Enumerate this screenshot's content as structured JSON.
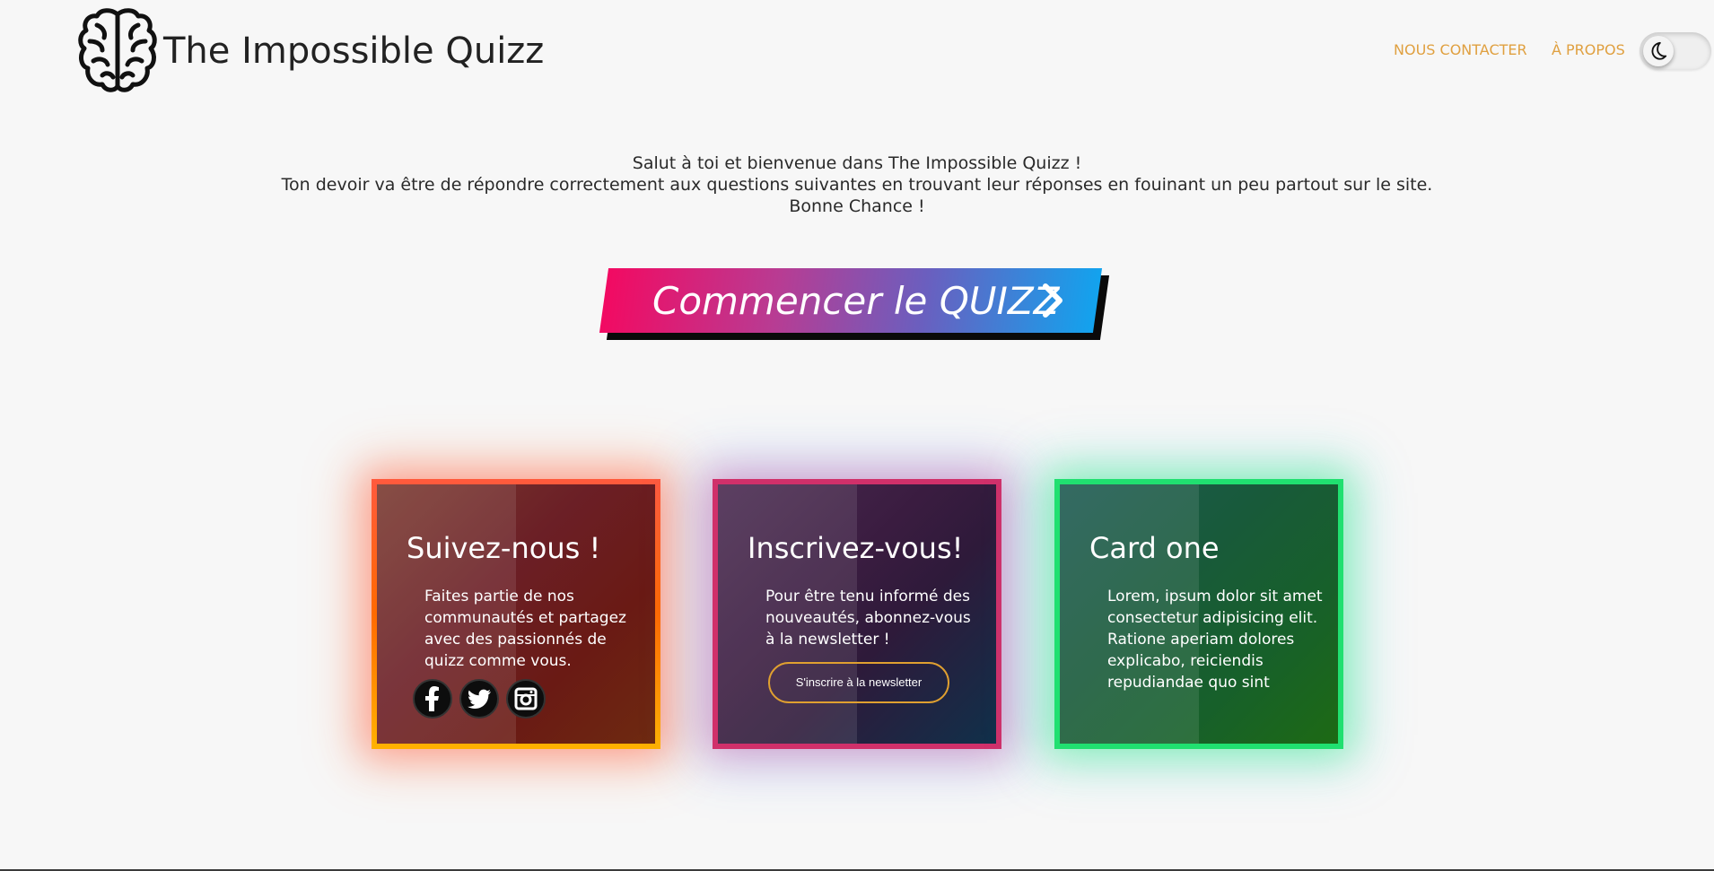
{
  "header": {
    "title": "The Impossible Quizz",
    "logo_icon": "brain-icon",
    "nav": [
      {
        "label": "NOUS CONTACTER"
      },
      {
        "label": "À PROPOS"
      }
    ],
    "theme_toggle_icon": "moon-icon"
  },
  "intro": {
    "line1": "Salut à toi et bienvenue dans The Impossible Quizz !",
    "line2": "Ton devoir va être de répondre correctement aux questions suivantes en trouvant leur réponses en fouinant un peu partout sur le site.",
    "line3": "Bonne Chance !"
  },
  "start_button": {
    "label": "Commencer le QUIZZ",
    "icon": "chevron-right-icon"
  },
  "cards": [
    {
      "title": "Suivez-nous !",
      "text": "Faites partie de nos communautés et partagez avec des passionnés de quizz comme vous.",
      "social_icons": [
        "facebook-icon",
        "twitter-icon",
        "instagram-icon"
      ]
    },
    {
      "title": "Inscrivez-vous!",
      "text": "Pour être tenu informé des nouveautés, abonnez-vous à la newsletter !",
      "button_label": "S'inscrire à la newsletter"
    },
    {
      "title": "Card one",
      "text": "Lorem, ipsum dolor sit amet consectetur adipisicing elit. Ratione aperiam dolores explicabo, reiciendis repudiandae quo sint"
    }
  ],
  "colors": {
    "background": "#f7f7f7",
    "nav_link": "#e0a040",
    "button_gradient_start": "#f20a62",
    "button_gradient_end": "#12a3ee",
    "card1_border": "#ff5a3c",
    "card2_border": "#d0306a",
    "card3_border": "#20e070",
    "newsletter_border": "#e0a030"
  }
}
